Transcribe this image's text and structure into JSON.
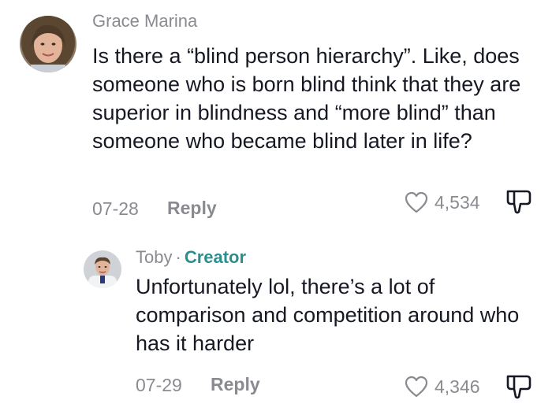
{
  "comments": [
    {
      "author": "Grace Marina",
      "text": "Is there a “blind person hierarchy”. Like, does someone who is born blind think that they are superior in blindness and “more blind” than someone who became blind later in life?",
      "date": "07-28",
      "reply_label": "Reply",
      "likes": "4,534",
      "avatar_icon": "user-avatar-photo"
    },
    {
      "author": "Toby",
      "separator": "·",
      "badge": "Creator",
      "text": "Unfortunately lol, there’s a lot of comparison and competition around who has it harder",
      "date": "07-29",
      "reply_label": "Reply",
      "likes": "4,346",
      "avatar_icon": "user-avatar-photo"
    }
  ],
  "icons": {
    "like": "heart-outline-icon",
    "dislike": "thumbs-down-outline-icon"
  },
  "colors": {
    "text": "#161823",
    "muted": "#8a8b91",
    "creator": "#2b8f8f"
  }
}
